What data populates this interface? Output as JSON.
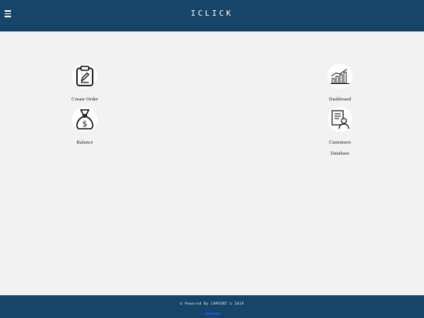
{
  "app": {
    "title": "ICLICK"
  },
  "header": {
    "menu_icon": "hamburger-icon",
    "background": "#17456a"
  },
  "tiles": [
    {
      "label": "Create Order",
      "icon": "clipboard-edit-icon"
    },
    {
      "label": "Dashboard",
      "icon": "bar-chart-icon"
    },
    {
      "label": "Balance",
      "icon": "money-bag-icon"
    },
    {
      "label": "Customers",
      "label2": "Database",
      "icon": "customer-database-icon"
    }
  ],
  "footer": {
    "text": "© Powered By CAMSENT © 2019",
    "background": "#17456a"
  }
}
